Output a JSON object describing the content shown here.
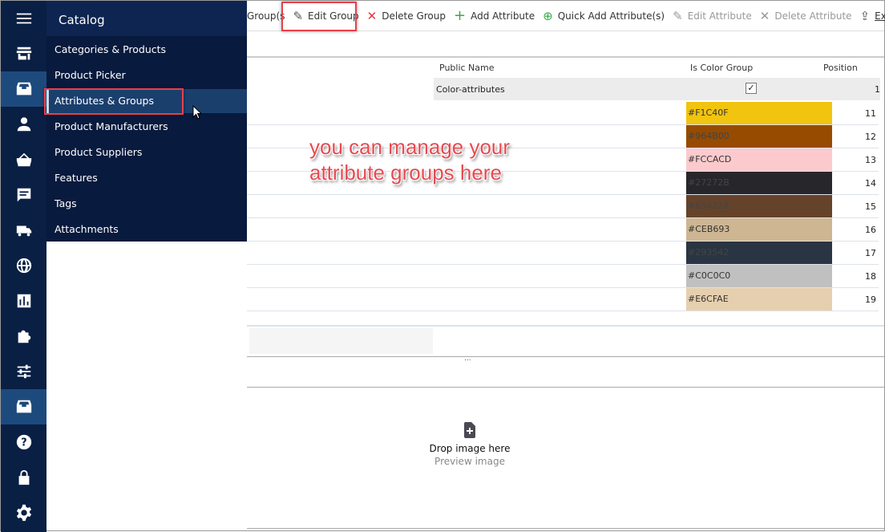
{
  "menu": {
    "title": "Catalog",
    "items": [
      {
        "label": "Categories & Products"
      },
      {
        "label": "Product Picker"
      },
      {
        "label": "Attributes & Groups"
      },
      {
        "label": "Product Manufacturers"
      },
      {
        "label": "Product Suppliers"
      },
      {
        "label": "Features"
      },
      {
        "label": "Tags"
      },
      {
        "label": "Attachments"
      }
    ],
    "selected": "Attributes & Groups"
  },
  "iconbar": [
    "menu-icon",
    "store-icon",
    "catalog-icon",
    "customer-icon",
    "basket-icon",
    "message-icon",
    "truck-icon",
    "globe-icon",
    "chart-icon",
    "puzzle-icon",
    "sliders-icon",
    "catalog-icon",
    "help-icon",
    "lock-icon",
    "gear-icon"
  ],
  "toolbar": {
    "truncated": "Group(s",
    "edit_group": "Edit Group",
    "delete_group": "Delete Group",
    "add_attribute": "Add Attribute",
    "quick_add": "Quick Add Attribute(s)",
    "edit_attribute": "Edit Attribute",
    "delete_attribute": "Delete Attribute",
    "export": "Export"
  },
  "grid": {
    "headers": {
      "public_name": "Public Name",
      "is_color": "Is Color Group",
      "position": "Position"
    },
    "group": {
      "public_name": "Color-attributes",
      "is_color": true,
      "position": "1"
    },
    "rows": [
      {
        "color": "#F1C40F",
        "position": "11"
      },
      {
        "color": "#964B00",
        "position": "12"
      },
      {
        "color": "#FCCACD",
        "position": "13"
      },
      {
        "color": "#27272B",
        "position": "14"
      },
      {
        "color": "#65432A",
        "position": "15"
      },
      {
        "color": "#CEB693",
        "position": "16"
      },
      {
        "color": "#293542",
        "position": "17"
      },
      {
        "color": "#C0C0C0",
        "position": "18"
      },
      {
        "color": "#E6CFAE",
        "position": "19"
      }
    ]
  },
  "annotation": {
    "line1": "you can manage your",
    "line2": "attribute groups here"
  },
  "dropzone": {
    "title": "Drop image here",
    "subtitle": "Preview image"
  },
  "splitter": "..."
}
